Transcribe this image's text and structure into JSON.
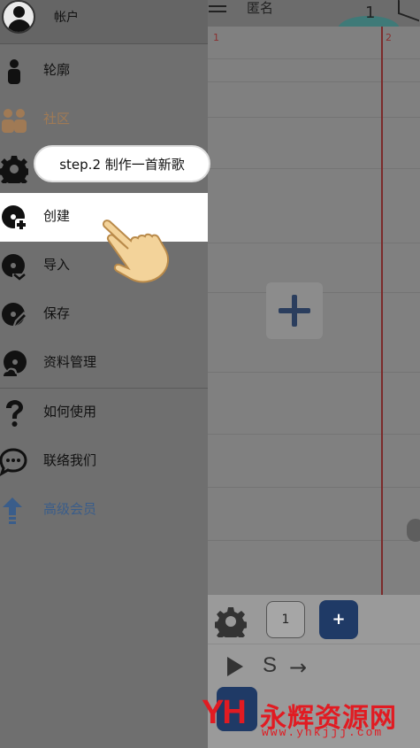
{
  "app": {
    "title": "匿名",
    "counter": "1",
    "track_markers": [
      "1",
      "2"
    ],
    "bottom": {
      "measure_value": "1",
      "add_label": "+",
      "s_label": "S",
      "arrow": "→"
    }
  },
  "drawer": {
    "header_label": "帐户",
    "items": [
      {
        "label": "轮廓",
        "icon": "person-icon"
      },
      {
        "label": "社区",
        "icon": "community-icon"
      },
      {
        "label": "",
        "icon": "gear-icon"
      },
      {
        "label": "创建",
        "icon": "create-disc-icon"
      },
      {
        "label": "导入",
        "icon": "import-disc-icon"
      },
      {
        "label": "保存",
        "icon": "save-disc-icon"
      },
      {
        "label": "资料管理",
        "icon": "cloud-disc-icon"
      },
      {
        "label": "如何使用",
        "icon": "question-icon"
      },
      {
        "label": "联络我们",
        "icon": "chat-icon"
      },
      {
        "label": "高级会员",
        "icon": "upgrade-arrow-icon"
      }
    ]
  },
  "tutorial": {
    "tooltip": "step.2 制作一首新歌"
  },
  "watermark": {
    "logo": "YH",
    "name": "永辉资源网",
    "url": "www.yhkjjj.com"
  },
  "colors": {
    "accent_blue": "#1f3a66",
    "brand_red": "#e11b22",
    "community_brown": "#a07a55"
  }
}
